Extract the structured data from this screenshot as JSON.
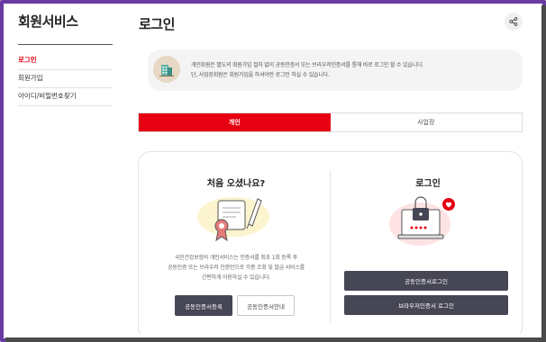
{
  "sidebar": {
    "title": "회원서비스",
    "items": [
      {
        "label": "로그인",
        "active": true
      },
      {
        "label": "회원가입",
        "active": false
      },
      {
        "label": "아이디/비밀번호찾기",
        "active": false
      }
    ]
  },
  "main": {
    "title": "로그인",
    "share_icon": "share-icon"
  },
  "notice": {
    "icon": "building-icon",
    "line1": "개인회원은 별도의 회원가입 절차 없이 공동인증서 또는 브라우저인증서를 통해 바로 로그인 할 수 있습니다.",
    "line2": "단, 사업장회원은 회원가입을 하셔야만 로그인 하실 수 있습니다."
  },
  "tabs": [
    {
      "label": "개인",
      "active": true
    },
    {
      "label": "사업장",
      "active": false
    }
  ],
  "left_column": {
    "title": "처음 오셨나요?",
    "desc_line1": "국민건강보험의 개인서비스는 인증서를 최초 1회 등록 후",
    "desc_line2": "공동인증 또는 브라우저 인증만으로 각종 조회 및 발급 서비스를",
    "desc_line3": "간편하게 이용하실 수 있습니다.",
    "register_button": "공동인증서등록",
    "guide_button": "공동인증서안내"
  },
  "right_column": {
    "title": "로그인",
    "cert_login_button": "공동인증서로그인",
    "browser_login_button": "브라우저인증서 로그인"
  },
  "colors": {
    "accent": "#e60012",
    "dark_button": "#464655",
    "frame": "#6a3aa3"
  }
}
